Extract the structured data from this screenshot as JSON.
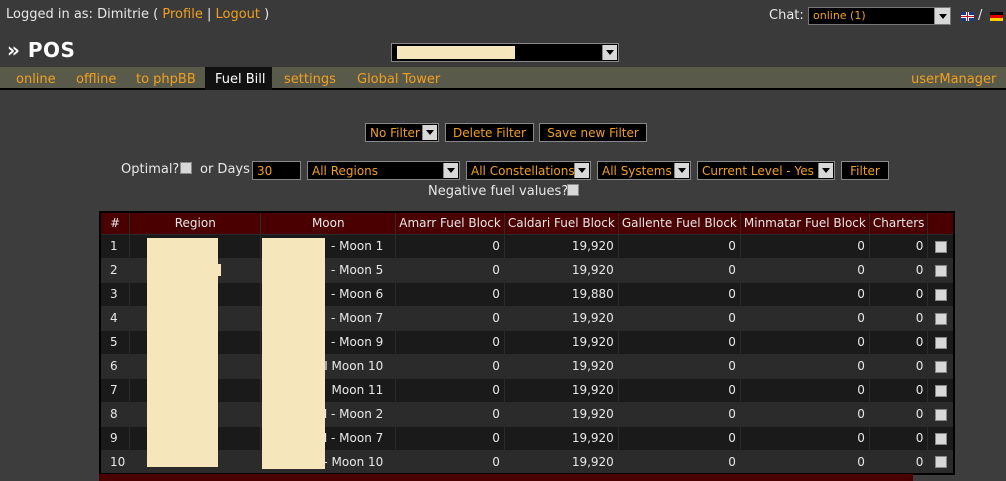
{
  "header": {
    "logged_in_prefix": "Logged in as: Dimitrie (",
    "profile_link": "Profile",
    "separator": "|",
    "logout_link": "Logout",
    "suffix": ")",
    "chat_label": "Chat:",
    "chat_status": "online (1)",
    "lang_separator": "/",
    "page_title": "» POS"
  },
  "nav": {
    "items": [
      "online",
      "offline",
      "to phpBB",
      "Fuel Bill",
      "settings",
      "Global Tower"
    ],
    "active": "Fuel Bill",
    "right_item": "userManager"
  },
  "filters": {
    "filter_select": "No Filter",
    "delete_filter": "Delete Filter",
    "save_filter": "Save new Filter",
    "optimal_label": "Optimal?",
    "or_days_label": "or Days",
    "days_value": "30",
    "regions": "All Regions",
    "constellations": "All Constellations",
    "systems": "All Systems",
    "level": "Current Level - Yes",
    "filter_button": "Filter",
    "negative_label": "Negative fuel values?"
  },
  "table": {
    "columns": [
      "#",
      "Region",
      "Moon",
      "Amarr Fuel Block",
      "Caldari Fuel Block",
      "Gallente Fuel Block",
      "Minmatar Fuel Block",
      "Charters",
      ""
    ],
    "rows": [
      {
        "n": "1",
        "moon": "- Moon 1",
        "amarr": "0",
        "caldari": "19,920",
        "gallente": "0",
        "minmatar": "0",
        "charters": "0"
      },
      {
        "n": "2",
        "moon": "- Moon 5",
        "amarr": "0",
        "caldari": "19,920",
        "gallente": "0",
        "minmatar": "0",
        "charters": "0"
      },
      {
        "n": "3",
        "moon": "- Moon 6",
        "amarr": "0",
        "caldari": "19,880",
        "gallente": "0",
        "minmatar": "0",
        "charters": "0"
      },
      {
        "n": "4",
        "moon": "- Moon 7",
        "amarr": "0",
        "caldari": "19,920",
        "gallente": "0",
        "minmatar": "0",
        "charters": "0"
      },
      {
        "n": "5",
        "moon": "- Moon 9",
        "amarr": "0",
        "caldari": "19,920",
        "gallente": "0",
        "minmatar": "0",
        "charters": "0"
      },
      {
        "n": "6",
        "moon": "I Moon 10",
        "amarr": "0",
        "caldari": "19,920",
        "gallente": "0",
        "minmatar": "0",
        "charters": "0"
      },
      {
        "n": "7",
        "moon": "Moon 11",
        "amarr": "0",
        "caldari": "19,920",
        "gallente": "0",
        "minmatar": "0",
        "charters": "0"
      },
      {
        "n": "8",
        "moon": "I - Moon 2",
        "amarr": "0",
        "caldari": "19,920",
        "gallente": "0",
        "minmatar": "0",
        "charters": "0"
      },
      {
        "n": "9",
        "moon": "I - Moon 7",
        "amarr": "0",
        "caldari": "19,920",
        "gallente": "0",
        "minmatar": "0",
        "charters": "0"
      },
      {
        "n": "10",
        "moon": "I - Moon 10",
        "amarr": "0",
        "caldari": "19,920",
        "gallente": "0",
        "minmatar": "0",
        "charters": "0"
      }
    ]
  },
  "colors": {
    "accent": "#f0a020",
    "header_row": "#4a0000",
    "navbar": "#5a5a4a",
    "redaction": "#f5e6bc"
  }
}
